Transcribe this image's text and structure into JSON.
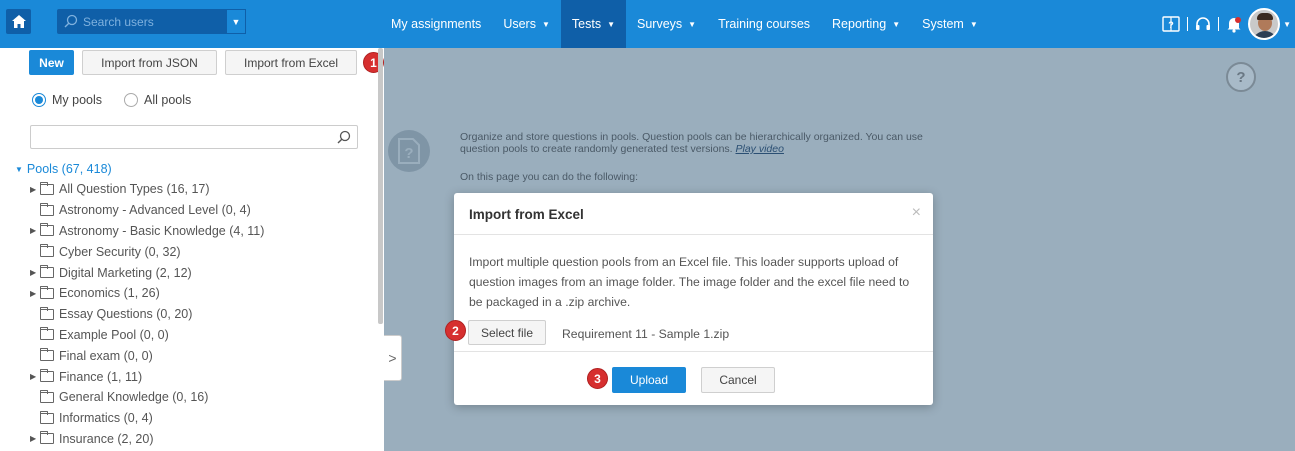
{
  "topbar": {
    "search_placeholder": "Search users",
    "nav": [
      {
        "label": "My assignments",
        "dropdown": false,
        "active": false
      },
      {
        "label": "Users",
        "dropdown": true,
        "active": false
      },
      {
        "label": "Tests",
        "dropdown": true,
        "active": true
      },
      {
        "label": "Surveys",
        "dropdown": true,
        "active": false
      },
      {
        "label": "Training courses",
        "dropdown": false,
        "active": false
      },
      {
        "label": "Reporting",
        "dropdown": true,
        "active": false
      },
      {
        "label": "System",
        "dropdown": true,
        "active": false
      }
    ],
    "icons": [
      "book-icon",
      "headset-icon",
      "bell-icon"
    ]
  },
  "toolbar": {
    "new_label": "New",
    "import_json_label": "Import from JSON",
    "import_excel_label": "Import from Excel"
  },
  "steps": {
    "one": "1",
    "two": "2",
    "three": "3"
  },
  "filter": {
    "my_pools_label": "My pools",
    "all_pools_label": "All pools",
    "selected": "My pools"
  },
  "tree": {
    "root_label": "Pools (67, 418)",
    "items": [
      {
        "label": "All Question Types (16, 17)",
        "expandable": true
      },
      {
        "label": "Astronomy - Advanced Level (0, 4)",
        "expandable": false
      },
      {
        "label": "Astronomy - Basic Knowledge (4, 11)",
        "expandable": true
      },
      {
        "label": "Cyber Security (0, 32)",
        "expandable": false
      },
      {
        "label": "Digital Marketing (2, 12)",
        "expandable": true
      },
      {
        "label": "Economics (1, 26)",
        "expandable": true
      },
      {
        "label": "Essay Questions (0, 20)",
        "expandable": false
      },
      {
        "label": "Example Pool (0, 0)",
        "expandable": false
      },
      {
        "label": "Final exam (0, 0)",
        "expandable": false
      },
      {
        "label": "Finance (1, 11)",
        "expandable": true
      },
      {
        "label": "General Knowledge (0, 16)",
        "expandable": false
      },
      {
        "label": "Informatics (0, 4)",
        "expandable": false
      },
      {
        "label": "Insurance (2, 20)",
        "expandable": true
      }
    ]
  },
  "content": {
    "help_label": "?",
    "intro_text": "Organize and store questions in pools. Question pools can be hierarchically organized. You can use question pools to create randomly generated test versions.",
    "play_video_label": "Play video",
    "intro_text_2": "On this page you can do the following:"
  },
  "modal": {
    "title": "Import from Excel",
    "close_label": "×",
    "body": "Import multiple question pools from an Excel file. This loader supports upload of question images from an image folder. The image folder and the excel file need to be packaged in a .zip archive.",
    "select_file_label": "Select file",
    "file_name": "Requirement 11 - Sample 1.zip",
    "upload_label": "Upload",
    "cancel_label": "Cancel"
  },
  "colors": {
    "accent": "#1a89d8",
    "accent_dark": "#0f5fa8",
    "badge": "#d62f2f",
    "overlay": "#9aaebd"
  }
}
